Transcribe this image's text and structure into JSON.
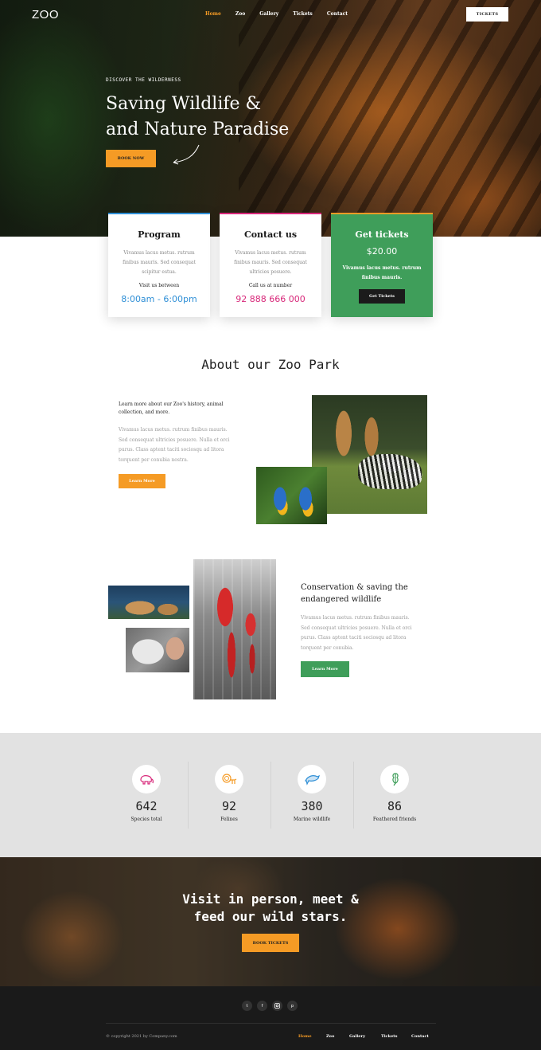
{
  "header": {
    "logo": "ZOO",
    "nav": [
      "Home",
      "Zoo",
      "Gallery",
      "Tickets",
      "Contact"
    ],
    "active": "Home",
    "tickets_button": "TICKETS"
  },
  "hero": {
    "kicker": "DISCOVER THE WILDERNESS",
    "title_line1": "Saving Wildlife &",
    "title_line2": "and Nature Paradise",
    "button": "BOOK NOW"
  },
  "cards": {
    "program": {
      "title": "Program",
      "desc": "Vivamus lacus metus. rutrum finibus mauris. Sed consequat scipitur estua.",
      "label": "Visit us between",
      "value": "8:00am - 6:00pm"
    },
    "contact": {
      "title": "Contact us",
      "desc": "Vivamus lacus metus. rutrum finibus mauris. Sed consequat ultricies posuere.",
      "label": "Call us at number",
      "value": "92 888 666 000"
    },
    "tickets": {
      "title": "Get tickets",
      "price": "$20.00",
      "desc": "Vivamus lacus metus. rutrum finibus mauris.",
      "button": "Get Tickets"
    }
  },
  "about": {
    "title": "About our Zoo Park",
    "lead": "Learn more about our Zoo's history, animal collection, and more.",
    "body": "Vivamus lacus metus. rutrum finibus mauris. Sed consequat ultricies posuere. Nulla et orci purus. Class aptent taciti sociosqu ad litora torquent per conubia nostra.",
    "button": "Learn More"
  },
  "conservation": {
    "title": "Conservation & saving the endangered wildlife",
    "body": "Vivamus lacus metus. rutrum finibus mauris. Sed consequat ultricies posuere. Nulla et orci purus. Class aptent taciti sociosqu ad litora torquent per conubia.",
    "button": "Learn More"
  },
  "stats": [
    {
      "value": "642",
      "label": "Species total",
      "icon": "elephant-icon",
      "color": "#d8287a"
    },
    {
      "value": "92",
      "label": "Felines",
      "icon": "lion-icon",
      "color": "#f59b25"
    },
    {
      "value": "380",
      "label": "Marine wildlife",
      "icon": "dolphin-icon",
      "color": "#2f8fd6"
    },
    {
      "value": "86",
      "label": "Feathered friends",
      "icon": "parrot-icon",
      "color": "#3f9e5a"
    }
  ],
  "cta": {
    "line1": "Visit in person, meet &",
    "line2": "feed our wild stars.",
    "button": "BOOK TICKETS"
  },
  "footer": {
    "social": [
      "twitter-icon",
      "facebook-icon",
      "instagram-icon",
      "pinterest-icon"
    ],
    "copyright": "© copyright 2021 by Company.com",
    "nav": [
      "Home",
      "Zoo",
      "Gallery",
      "Tickets",
      "Contact"
    ]
  },
  "colors": {
    "accent_orange": "#f59b25",
    "accent_green": "#3f9e5a",
    "accent_blue": "#2f8fd6",
    "accent_pink": "#d8287a"
  }
}
